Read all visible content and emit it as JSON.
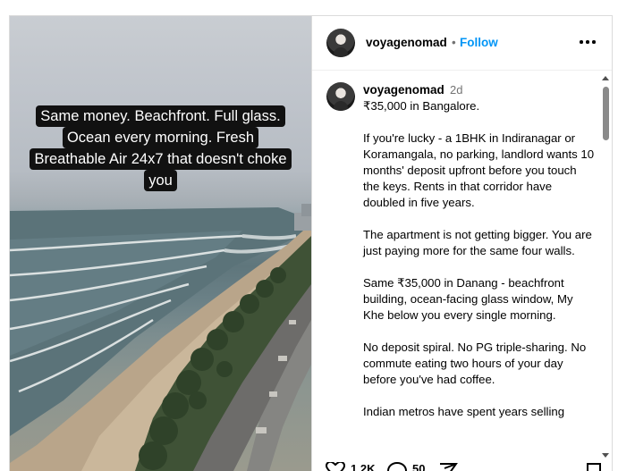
{
  "photo": {
    "caption_lines": [
      "Same money. Beachfront. Full glass.",
      "Ocean every morning. Fresh",
      "Breathable Air 24x7 that doesn't choke",
      "you"
    ]
  },
  "header": {
    "username": "voyagenomad",
    "separator": "•",
    "follow_label": "Follow",
    "more_icon": "more-horizontal-icon"
  },
  "post": {
    "username": "voyagenomad",
    "time_ago": "2d",
    "paragraphs": [
      "₹35,000 in Bangalore.",
      "If you're lucky - a 1BHK in Indiranagar or Koramangala, no parking, landlord wants 10 months' deposit upfront before you touch the keys. Rents in that corridor have doubled in five years.",
      "The apartment is not getting bigger. You are just paying more for the same four walls.",
      "Same ₹35,000 in Danang - beachfront building, ocean-facing glass window, My Khe below you every single morning.",
      "No deposit spiral. No PG triple-sharing. No commute eating two hours of your day before you've had coffee.",
      "Indian metros have spent years selling"
    ]
  },
  "actions": {
    "likes": "1.2K",
    "comments": "50"
  }
}
